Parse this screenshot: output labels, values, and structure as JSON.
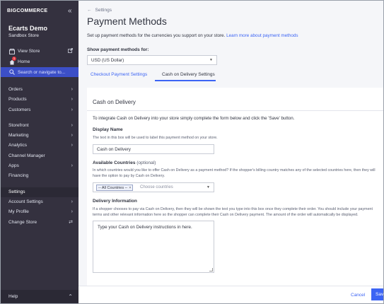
{
  "sidebar": {
    "logo": "BIGCOMMERCE",
    "store_name": "Ecarts Demo",
    "store_sub": "Sandbox Store",
    "view_store": "View Store",
    "home": "Home",
    "home_badge": "1",
    "search": "Search or navigate to...",
    "menu1": [
      "Orders",
      "Products",
      "Customers"
    ],
    "menu2": [
      "Storefront",
      "Marketing",
      "Analytics",
      "Channel Manager",
      "Apps",
      "Financing"
    ],
    "menu3": [
      "Settings",
      "Account Settings",
      "My Profile",
      "Change Store"
    ],
    "help": "Help"
  },
  "main": {
    "breadcrumb": "Settings",
    "title": "Payment Methods",
    "intro": "Set up payment methods for the currencies you support on your store.",
    "intro_link": "Learn more about payment methods",
    "show_label": "Show payment methods for:",
    "currency": "USD (US Dollar)",
    "tabs": [
      "Checkout Payment Settings",
      "Cash on Delivery Settings"
    ],
    "active_tab": "Cash on Delivery Settings"
  },
  "card": {
    "title": "Cash on Delivery",
    "instructions": "To integrate Cash on Delivery into your store simply complete the form below and click the 'Save' button.",
    "display_name_label": "Display Name",
    "display_name_help": "The text in this box will be used to label this payment method on your store.",
    "display_name_value": "Cash on Delivery",
    "countries_label": "Available Countries",
    "countries_optional": "(optional)",
    "countries_help_1": "In which countries would you like to offer Cash on Delivery as a payment method? If the shopper's billing country matches any of the selected countries here, then they will",
    "countries_help_2": "have the option to pay by Cash on Delivery.",
    "countries_chip": "-- All Countries --",
    "countries_placeholder": "Choose countries",
    "delivery_label": "Delivery Information",
    "delivery_help_1": "If a shopper chooses to pay via Cash on Delivery, then they will be shown the text you type into this box once they complete their order. You should include your payment",
    "delivery_help_2": "terms and other relevant information here so the shopper can complete their Cash on Delivery payment. The amount of the order will automatically be displayed.",
    "delivery_value": "Type your Cash on Delivery instructions in here."
  },
  "footer": {
    "cancel": "Cancel",
    "save": "Save"
  },
  "colors": {
    "sidebar_bg": "#34313f",
    "accent": "#3c64f4"
  }
}
